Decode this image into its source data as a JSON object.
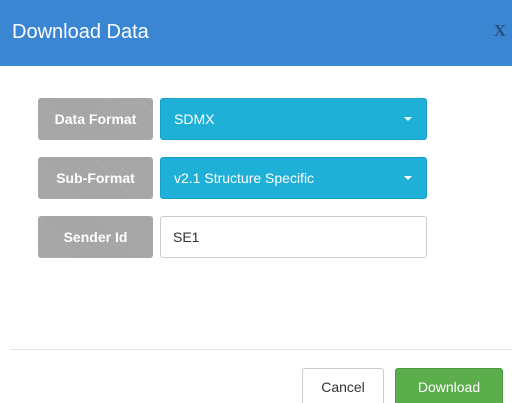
{
  "dialog": {
    "title": "Download Data",
    "close_label": "X",
    "header_color": "#3a86d3"
  },
  "form": {
    "data_format": {
      "label": "Data Format",
      "value": "SDMX"
    },
    "sub_format": {
      "label": "Sub-Format",
      "value": "v2.1 Structure Specific"
    },
    "sender_id": {
      "label": "Sender Id",
      "value": "SE1"
    }
  },
  "footer": {
    "cancel_label": "Cancel",
    "download_label": "Download"
  },
  "colors": {
    "dropdown": "#1fb0d8",
    "label_bg": "#a5a5a5",
    "download_button": "#5cae4c"
  }
}
